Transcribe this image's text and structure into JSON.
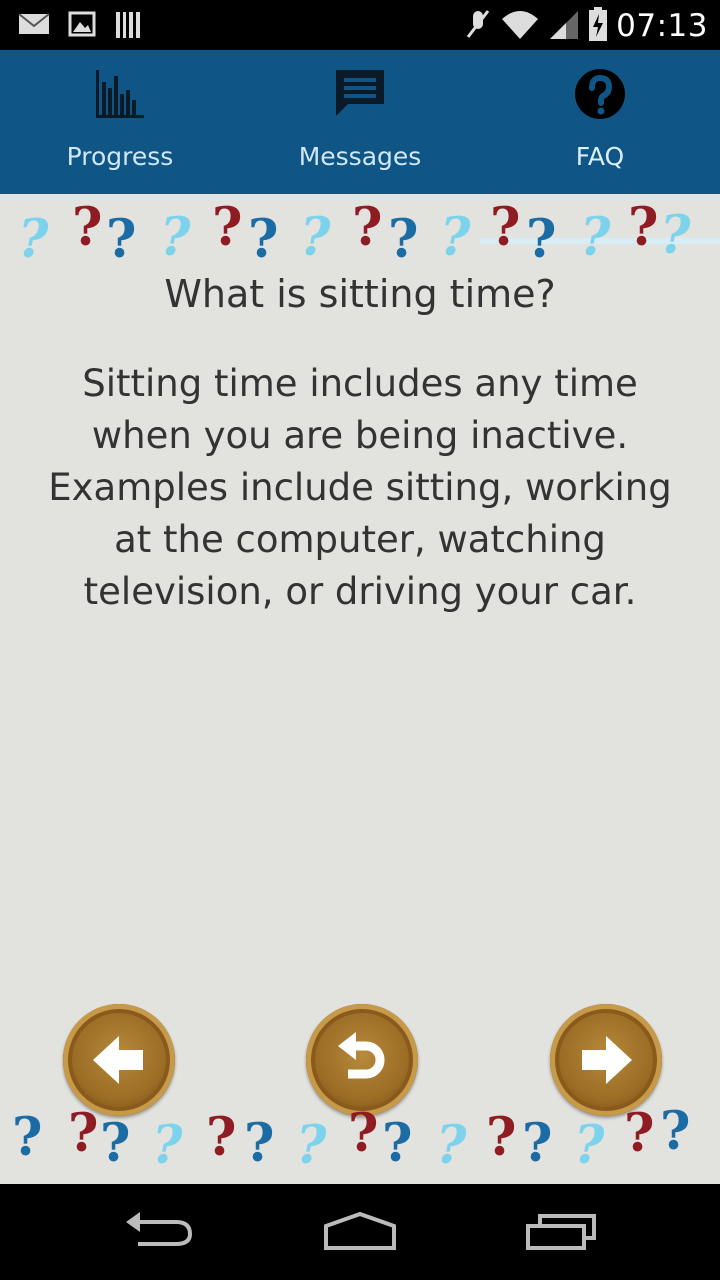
{
  "status_bar": {
    "time": "07:13",
    "icons": [
      "mail-icon",
      "image-icon",
      "barcode-icon",
      "mute-icon",
      "wifi-icon",
      "signal-icon",
      "battery-charging-icon"
    ]
  },
  "tabs": [
    {
      "label": "Progress",
      "icon": "bar-chart-icon",
      "selected": false
    },
    {
      "label": "Messages",
      "icon": "chat-bubble-icon",
      "selected": false
    },
    {
      "label": "FAQ",
      "icon": "help-circle-icon",
      "selected": true
    }
  ],
  "faq": {
    "question": "What is sitting time?",
    "answer": "Sitting time includes any time when you are being inactive. Examples include sitting, working at the computer, watching television, or driving your car."
  },
  "controls": {
    "previous_icon": "arrow-left-icon",
    "back_icon": "undo-icon",
    "next_icon": "arrow-right-icon"
  },
  "system_nav": {
    "icons": [
      "back-icon",
      "home-icon",
      "recent-apps-icon"
    ]
  },
  "colors": {
    "tab_bar": "#0f5585",
    "background": "#e2e2df",
    "question_mark_light": "#7dd3ec",
    "question_mark_dark": "#8f1c22",
    "question_mark_blue": "#1b6ba4",
    "button_bronze": "#9a6c25"
  }
}
